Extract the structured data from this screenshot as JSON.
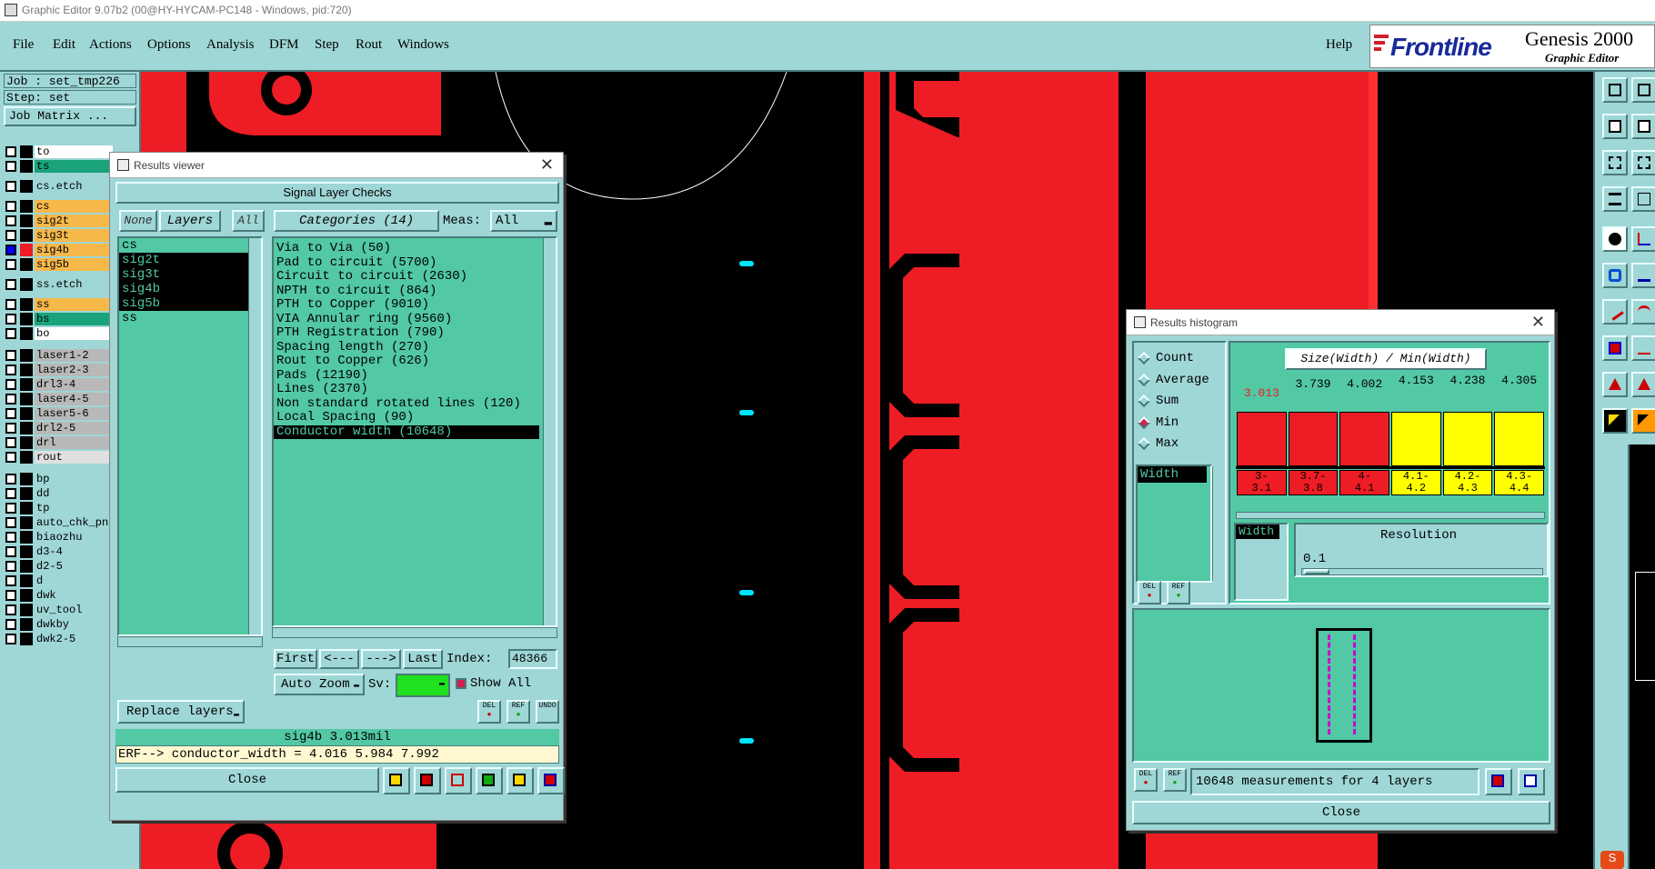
{
  "titlebar": {
    "title": "Graphic Editor 9.07b2 (00@HY-HYCAM-PC148 - Windows, pid:720)"
  },
  "menubar": {
    "items": [
      "File",
      "Edit",
      "Actions",
      "Options",
      "Analysis",
      "DFM",
      "Step",
      "Rout",
      "Windows"
    ],
    "help": "Help",
    "brand": "Frontline",
    "product": "Genesis 2000",
    "product_sub": "Graphic Editor"
  },
  "job": {
    "job_label": "Job  : set_tmp226",
    "step_label": "Step: set",
    "matrix_button": "Job Matrix ..."
  },
  "layers": [
    {
      "name": "to",
      "color": "#ffffff"
    },
    {
      "name": "ts",
      "color": "#1aa37a"
    },
    {
      "name": "cs.etch",
      "color": "#9fd6d6"
    },
    {
      "name": "cs",
      "color": "#f7b84a"
    },
    {
      "name": "sig2t",
      "color": "#f7b84a"
    },
    {
      "name": "sig3t",
      "color": "#f7b84a"
    },
    {
      "name": "sig4b",
      "color": "#f7b84a"
    },
    {
      "name": "sig5b",
      "color": "#f7b84a"
    },
    {
      "name": "ss.etch",
      "color": "#9fd6d6"
    },
    {
      "name": "ss",
      "color": "#f7b84a"
    },
    {
      "name": "bs",
      "color": "#1aa37a"
    },
    {
      "name": "bo",
      "color": "#ffffff"
    },
    {
      "name": "laser1-2",
      "color": "#b8b8b8"
    },
    {
      "name": "laser2-3",
      "color": "#b8b8b8"
    },
    {
      "name": "drl3-4",
      "color": "#b8b8b8"
    },
    {
      "name": "laser4-5",
      "color": "#b8b8b8"
    },
    {
      "name": "laser5-6",
      "color": "#b8b8b8"
    },
    {
      "name": "drl2-5",
      "color": "#b8b8b8"
    },
    {
      "name": "drl",
      "color": "#b8b8b8"
    },
    {
      "name": "rout",
      "color": "#e0e0e0"
    },
    {
      "name": "bp",
      "color": "#9fd6d6"
    },
    {
      "name": "dd",
      "color": "#9fd6d6"
    },
    {
      "name": "tp",
      "color": "#9fd6d6"
    },
    {
      "name": "auto_chk_pn",
      "color": "#9fd6d6"
    },
    {
      "name": "biaozhu",
      "color": "#9fd6d6"
    },
    {
      "name": "d3-4",
      "color": "#9fd6d6"
    },
    {
      "name": "d2-5",
      "color": "#9fd6d6"
    },
    {
      "name": "d",
      "color": "#9fd6d6"
    },
    {
      "name": "dwk",
      "color": "#9fd6d6"
    },
    {
      "name": "uv_tool",
      "color": "#9fd6d6"
    },
    {
      "name": "dwkby",
      "color": "#9fd6d6"
    },
    {
      "name": "dwk2-5",
      "color": "#9fd6d6"
    }
  ],
  "results_viewer": {
    "title": "Results viewer",
    "header": "Signal Layer Checks",
    "none_btn": "None",
    "layers_btn": "Layers",
    "all_btn": "All",
    "categories_btn": "Categories (14)",
    "meas_label": "Meas:",
    "meas_value": "All",
    "layer_list": [
      "cs",
      "sig2t",
      "sig3t",
      "sig4b",
      "sig5b",
      "ss"
    ],
    "categories": [
      "Via to Via (50)",
      "Pad to circuit (5700)",
      "Circuit to circuit (2630)",
      "NPTH to circuit (864)",
      "PTH to Copper (9010)",
      "VIA Annular ring (9560)",
      "PTH Registration (790)",
      "Spacing length (270)",
      "Rout to Copper (626)",
      "Pads (12190)",
      "Lines (2370)",
      "Non standard rotated lines (120)",
      "Local Spacing (90)",
      "Conductor width (10648)"
    ],
    "first": "First",
    "prev": "<---",
    "next": "--->",
    "last": "Last",
    "index_label": "Index:",
    "index_value": "48366",
    "auto_zoom": "Auto Zoom",
    "sv_label": "Sv:",
    "show_all": "Show All",
    "replace_layers": "Replace layers",
    "status": "sig4b 3.013mil",
    "erf": "ERF--> conductor_width = 4.016 5.984 7.992",
    "close": "Close",
    "del": "DEL",
    "ref": "REF",
    "undo": "UNDO"
  },
  "histogram": {
    "title": "Results histogram",
    "options": [
      "Count",
      "Average",
      "Sum",
      "Min",
      "Max"
    ],
    "selected_option": "Min",
    "chart_title": "Size(Width) / Min(Width)",
    "measure_list": [
      "Width"
    ],
    "width_tag": "Width",
    "resolution_label": "Resolution",
    "resolution_value": "0.1",
    "summary": "10648 measurements for 4 layers",
    "close": "Close",
    "del": "DEL",
    "ref": "REF",
    "colors": {
      "red": "#ee1c24",
      "yellow": "#ffff00"
    }
  },
  "chart_data": {
    "type": "bar",
    "title": "Size(Width) / Min(Width)",
    "categories": [
      "3-3.1",
      "3.7-3.8",
      "4-4.1",
      "4.1-4.2",
      "4.2-4.3",
      "4.3-4.4"
    ],
    "category_labels_top": [
      "3-",
      "3.7-",
      "4-",
      "4.1-",
      "4.2-",
      "4.3-"
    ],
    "category_labels_bottom": [
      "3.1",
      "3.8",
      "4.1",
      "4.2",
      "4.3",
      "4.4"
    ],
    "values": [
      3.013,
      3.739,
      4.002,
      4.153,
      4.238,
      4.305
    ],
    "value_labels": [
      "3.013",
      "3.739",
      "4.002",
      "4.153",
      "4.238",
      "4.305"
    ],
    "bar_colors": [
      "#ee1c24",
      "#ee1c24",
      "#ee1c24",
      "#ffff00",
      "#ffff00",
      "#ffff00"
    ],
    "bar_heights_normalized": [
      0.76,
      0.76,
      0.76,
      0.76,
      0.76,
      0.76
    ]
  }
}
